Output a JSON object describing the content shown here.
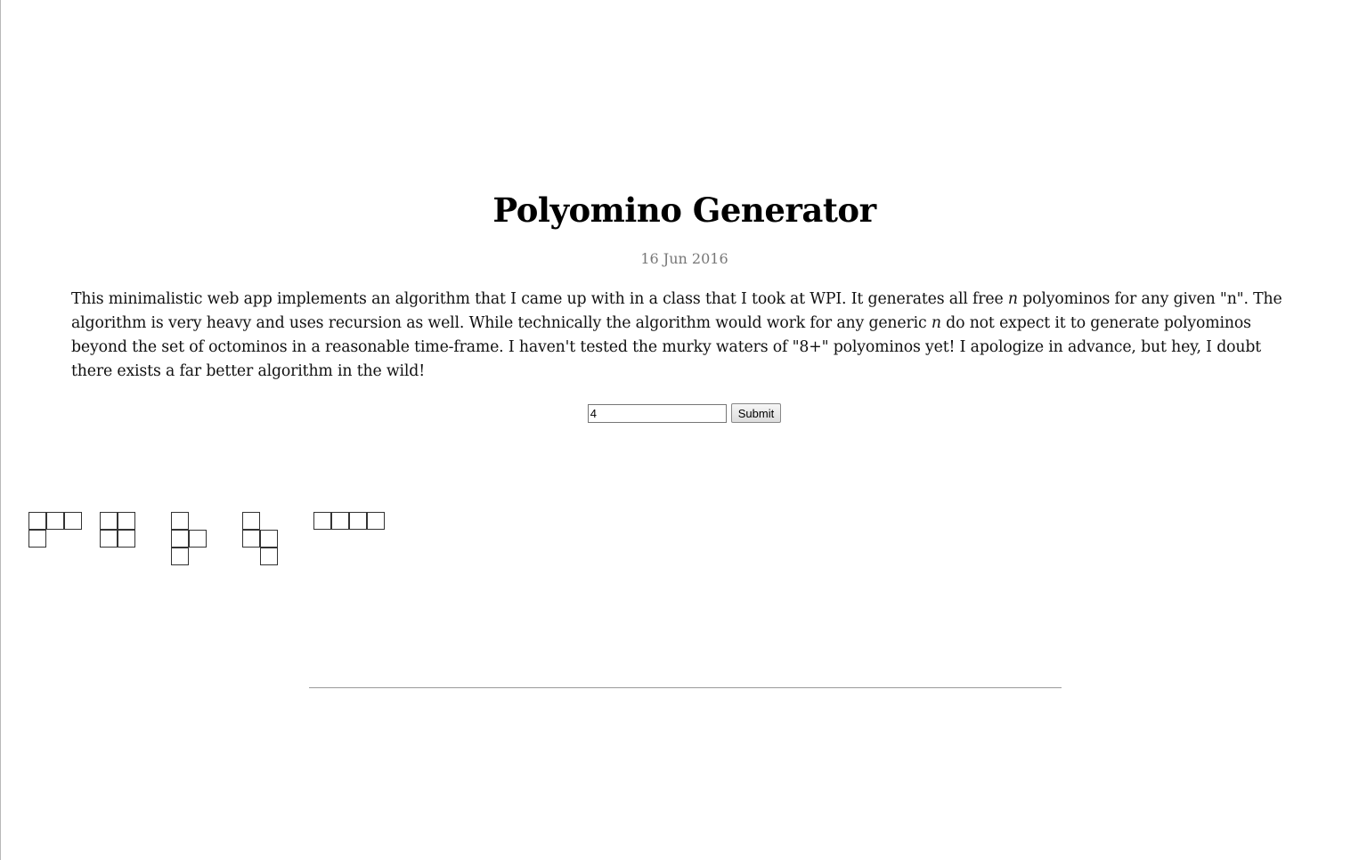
{
  "page": {
    "title": "Polyomino Generator",
    "date": "16 Jun 2016"
  },
  "intro": {
    "part1": "This minimalistic web app implements an algorithm that I came up with in a class that I took at WPI. It generates all free ",
    "italic1": "n",
    "part2": " polyominos for any given \"n\". The algorithm is very heavy and uses recursion as well. While technically the algorithm would work for any generic ",
    "italic2": "n",
    "part3": " do not expect it to generate polyominos beyond the set of octominos in a reasonable time-frame. I haven't tested the murky waters of \"8+\" polyominos yet! I apologize in advance, but hey, I doubt there exists a far better algorithm in the wild!"
  },
  "form": {
    "n_value": "4",
    "submit_label": "Submit"
  },
  "polyominos": [
    {
      "name": "L-tetromino",
      "cells": [
        [
          0,
          0
        ],
        [
          1,
          0
        ],
        [
          2,
          0
        ],
        [
          0,
          1
        ]
      ]
    },
    {
      "name": "O-tetromino",
      "cells": [
        [
          0,
          0
        ],
        [
          1,
          0
        ],
        [
          0,
          1
        ],
        [
          1,
          1
        ]
      ]
    },
    {
      "name": "T-tetromino",
      "cells": [
        [
          0,
          0
        ],
        [
          0,
          1
        ],
        [
          1,
          1
        ],
        [
          0,
          2
        ]
      ]
    },
    {
      "name": "S-tetromino",
      "cells": [
        [
          0,
          0
        ],
        [
          0,
          1
        ],
        [
          1,
          1
        ],
        [
          1,
          2
        ]
      ]
    },
    {
      "name": "I-tetromino",
      "cells": [
        [
          0,
          0
        ],
        [
          1,
          0
        ],
        [
          2,
          0
        ],
        [
          3,
          0
        ]
      ]
    }
  ]
}
